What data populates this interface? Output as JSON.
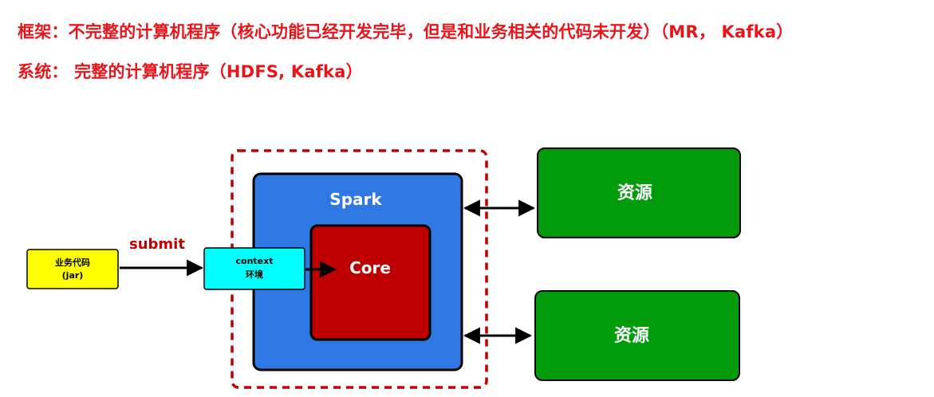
{
  "header": {
    "line1": "框架：不完整的计算机程序（核心功能已经开发完毕，但是和业务相关的代码未开发）（MR， Kafka）",
    "line2": "系统： 完整的计算机程序（HDFS, Kafka）"
  },
  "diagram": {
    "business_code": {
      "line1": "业务代码",
      "line2": "(jar)"
    },
    "submit_label": "submit",
    "context": {
      "line1": "context",
      "line2": "环境"
    },
    "spark_label": "Spark",
    "core_label": "Core",
    "resource_top": "资源",
    "resource_bottom": "资源"
  },
  "colors": {
    "header_text": "#e8141b",
    "spark_fill": "#2f78e4",
    "core_fill": "#c00000",
    "resource_fill": "#029b0c",
    "business_code_fill": "#ffff00",
    "context_fill": "#00ffff",
    "dashed_border": "#c00000",
    "submit_text": "#c00000"
  }
}
